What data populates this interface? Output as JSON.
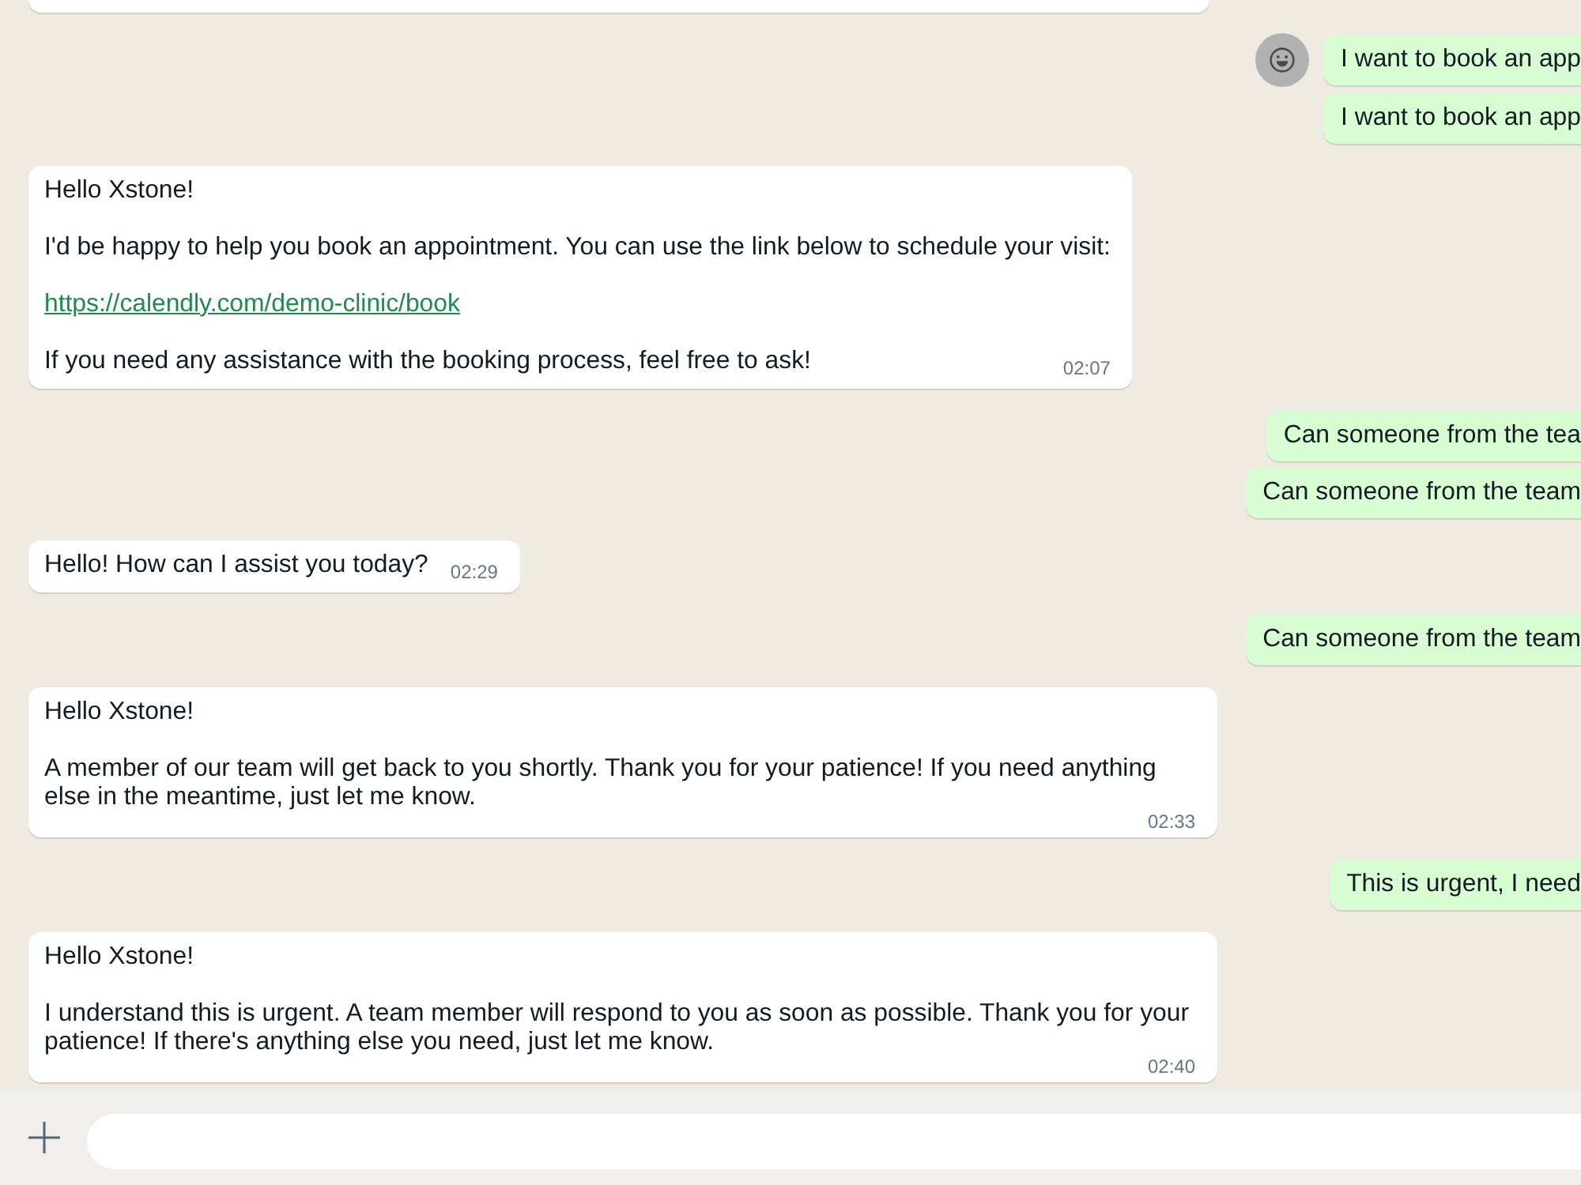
{
  "messages": [
    {
      "kind": "cut_off"
    },
    {
      "kind": "outgoing",
      "avatar": true,
      "text": "I want to book an app"
    },
    {
      "kind": "outgoing",
      "avatar": false,
      "text": "I want to book an app"
    },
    {
      "kind": "incoming",
      "paragraphs": [
        {
          "kind": "text",
          "text": "Hello Xstone!"
        },
        {
          "kind": "text",
          "text": "I'd be happy to help you book an appointment. You can use the link below to schedule your visit:"
        },
        {
          "kind": "link",
          "text": "https://calendly.com/demo-clinic/book"
        },
        {
          "kind": "text",
          "text": "If you need any assistance with the booking process, feel free to ask!"
        }
      ],
      "time": "02:07"
    },
    {
      "kind": "outgoing",
      "avatar": false,
      "text": "Can someone from the tea"
    },
    {
      "kind": "outgoing",
      "avatar": false,
      "text": "Can someone from the team"
    },
    {
      "kind": "incoming",
      "paragraphs": [
        {
          "kind": "text",
          "text": "Hello! How can I assist you today?"
        }
      ],
      "time": "02:29"
    },
    {
      "kind": "outgoing",
      "avatar": false,
      "text": "Can someone from the team"
    },
    {
      "kind": "incoming",
      "paragraphs": [
        {
          "kind": "text",
          "text": "Hello Xstone!"
        },
        {
          "kind": "text",
          "text": "A member of our team will get back to you shortly. Thank you for your patience! If you need anything else in the meantime, just let me know."
        }
      ],
      "time": "02:33"
    },
    {
      "kind": "outgoing",
      "avatar": false,
      "text": "This is urgent, I need"
    },
    {
      "kind": "incoming",
      "paragraphs": [
        {
          "kind": "text",
          "text": "Hello Xstone!"
        },
        {
          "kind": "text",
          "text": "I understand this is urgent. A team member will respond to you as soon as possible. Thank you for your patience! If there's anything else you need, just let me know."
        }
      ],
      "time": "02:40"
    }
  ]
}
